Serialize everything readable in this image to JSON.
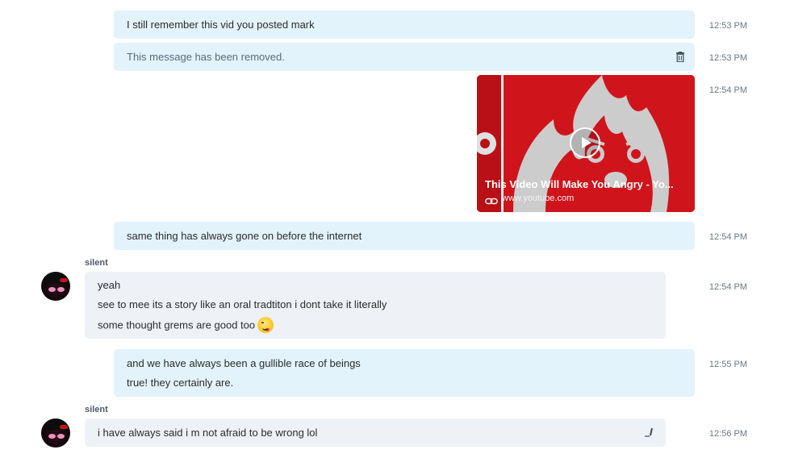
{
  "messages": [
    {
      "text": "I still remember this vid you posted mark",
      "time": "12:53 PM"
    },
    {
      "text": "This message has been removed.",
      "time": "12:53 PM",
      "icon": "trash-icon"
    },
    {
      "time": "12:54 PM",
      "video": {
        "title": "This Video Will Make You Angry - Yo...",
        "url": "www.youtube.com"
      }
    },
    {
      "text": "same thing has always gone on before the internet",
      "time": "12:54 PM"
    },
    {
      "sender": "silent",
      "lines": [
        "yeah",
        "see  to mee its a story like an oral tradtiton  i dont take it literally",
        "some thought grems are good too"
      ],
      "time": "12:54 PM",
      "emoji": "tongue-wink-emoji"
    },
    {
      "lines": [
        "and we have always been a gullible race of beings",
        "true!  they certainly are."
      ],
      "time": "12:55 PM"
    },
    {
      "sender": "silent",
      "text": "i have always said i m not afraid to be wrong lol",
      "time": "12:56 PM",
      "icon": "edit-icon"
    }
  ],
  "colors": {
    "outgoing_bubble": "#e3f3fc",
    "incoming_bubble": "#eef2f7",
    "video_bg": "#d0141b",
    "timestamp": "#6a7886"
  }
}
